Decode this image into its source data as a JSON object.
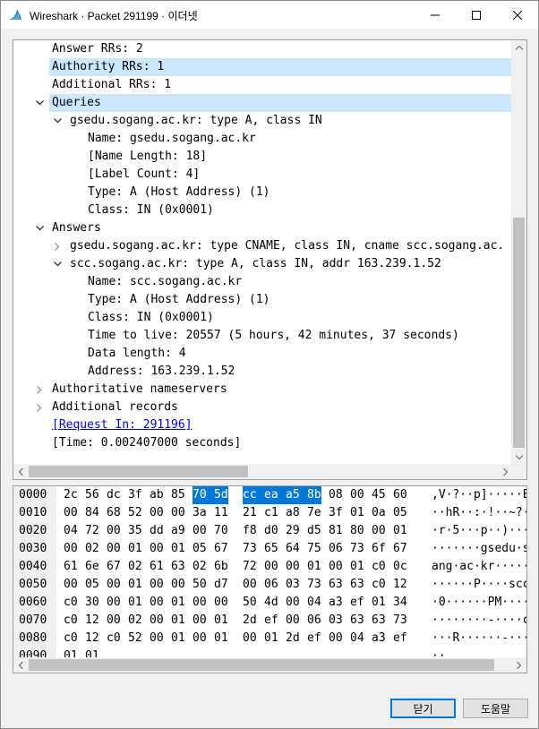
{
  "window": {
    "title": "Wireshark · Packet 291199 · 이더넷"
  },
  "icons": {
    "app": "wireshark-fin-icon",
    "minimize": "minimize-icon",
    "maximize": "maximize-icon",
    "close": "close-icon"
  },
  "tree": {
    "rows": [
      {
        "text": "Answer RRs: 2",
        "indent": 3,
        "arrow": "none"
      },
      {
        "text": "Authority RRs: 1",
        "indent": 3,
        "arrow": "none",
        "selected": "light"
      },
      {
        "text": "Additional RRs: 1",
        "indent": 3,
        "arrow": "none"
      },
      {
        "text": "Queries",
        "indent": 3,
        "arrow": "down",
        "selected": "light"
      },
      {
        "text": "gsedu.sogang.ac.kr: type A, class IN",
        "indent": 5,
        "arrow": "down"
      },
      {
        "text": "Name: gsedu.sogang.ac.kr",
        "indent": 7,
        "arrow": "none"
      },
      {
        "text": "[Name Length: 18]",
        "indent": 7,
        "arrow": "none"
      },
      {
        "text": "[Label Count: 4]",
        "indent": 7,
        "arrow": "none"
      },
      {
        "text": "Type: A (Host Address) (1)",
        "indent": 7,
        "arrow": "none"
      },
      {
        "text": "Class: IN (0x0001)",
        "indent": 7,
        "arrow": "none"
      },
      {
        "text": "Answers",
        "indent": 3,
        "arrow": "down"
      },
      {
        "text": "gsedu.sogang.ac.kr: type CNAME, class IN, cname scc.sogang.ac.",
        "indent": 5,
        "arrow": "right"
      },
      {
        "text": "scc.sogang.ac.kr: type A, class IN, addr 163.239.1.52",
        "indent": 5,
        "arrow": "down"
      },
      {
        "text": "Name: scc.sogang.ac.kr",
        "indent": 7,
        "arrow": "none"
      },
      {
        "text": "Type: A (Host Address) (1)",
        "indent": 7,
        "arrow": "none"
      },
      {
        "text": "Class: IN (0x0001)",
        "indent": 7,
        "arrow": "none"
      },
      {
        "text": "Time to live: 20557 (5 hours, 42 minutes, 37 seconds)",
        "indent": 7,
        "arrow": "none"
      },
      {
        "text": "Data length: 4",
        "indent": 7,
        "arrow": "none"
      },
      {
        "text": "Address: 163.239.1.52",
        "indent": 7,
        "arrow": "none"
      },
      {
        "text": "Authoritative nameservers",
        "indent": 3,
        "arrow": "right"
      },
      {
        "text": "Additional records",
        "indent": 3,
        "arrow": "right"
      },
      {
        "text": "[Request In: 291196]",
        "indent": 3,
        "arrow": "none",
        "link": true
      },
      {
        "text": "[Time: 0.002407000 seconds]",
        "indent": 3,
        "arrow": "none"
      }
    ]
  },
  "hex": {
    "rows": [
      {
        "offset": "0000",
        "bytes": [
          "2c",
          "56",
          "dc",
          "3f",
          "ab",
          "85",
          "70",
          "5d",
          "cc",
          "ea",
          "a5",
          "8b",
          "08",
          "00",
          "45",
          "60"
        ],
        "ascii": ",V·?··p]·····E`",
        "hl": [
          6,
          11
        ]
      },
      {
        "offset": "0010",
        "bytes": [
          "00",
          "84",
          "68",
          "52",
          "00",
          "00",
          "3a",
          "11",
          "21",
          "c1",
          "a8",
          "7e",
          "3f",
          "01",
          "0a",
          "05"
        ],
        "ascii": "··hR··:·!··~?···"
      },
      {
        "offset": "0020",
        "bytes": [
          "04",
          "72",
          "00",
          "35",
          "dd",
          "a9",
          "00",
          "70",
          "f8",
          "d0",
          "29",
          "d5",
          "81",
          "80",
          "00",
          "01"
        ],
        "ascii": "·r·5···p··)·····"
      },
      {
        "offset": "0030",
        "bytes": [
          "00",
          "02",
          "00",
          "01",
          "00",
          "01",
          "05",
          "67",
          "73",
          "65",
          "64",
          "75",
          "06",
          "73",
          "6f",
          "67"
        ],
        "ascii": "·······gsedu·sog"
      },
      {
        "offset": "0040",
        "bytes": [
          "61",
          "6e",
          "67",
          "02",
          "61",
          "63",
          "02",
          "6b",
          "72",
          "00",
          "00",
          "01",
          "00",
          "01",
          "c0",
          "0c"
        ],
        "ascii": "ang·ac·kr·······"
      },
      {
        "offset": "0050",
        "bytes": [
          "00",
          "05",
          "00",
          "01",
          "00",
          "00",
          "50",
          "d7",
          "00",
          "06",
          "03",
          "73",
          "63",
          "63",
          "c0",
          "12"
        ],
        "ascii": "······P····scc··"
      },
      {
        "offset": "0060",
        "bytes": [
          "c0",
          "30",
          "00",
          "01",
          "00",
          "01",
          "00",
          "00",
          "50",
          "4d",
          "00",
          "04",
          "a3",
          "ef",
          "01",
          "34"
        ],
        "ascii": "·0······PM·····4"
      },
      {
        "offset": "0070",
        "bytes": [
          "c0",
          "12",
          "00",
          "02",
          "00",
          "01",
          "00",
          "01",
          "2d",
          "ef",
          "00",
          "06",
          "03",
          "63",
          "63",
          "73"
        ],
        "ascii": "········-····ccs"
      },
      {
        "offset": "0080",
        "bytes": [
          "c0",
          "12",
          "c0",
          "52",
          "00",
          "01",
          "00",
          "01",
          "00",
          "01",
          "2d",
          "ef",
          "00",
          "04",
          "a3",
          "ef"
        ],
        "ascii": "···R······-·····"
      },
      {
        "offset": "0090",
        "bytes": [
          "01",
          "01"
        ],
        "ascii": "··"
      }
    ]
  },
  "buttons": {
    "close": "닫기",
    "help": "도움말"
  }
}
